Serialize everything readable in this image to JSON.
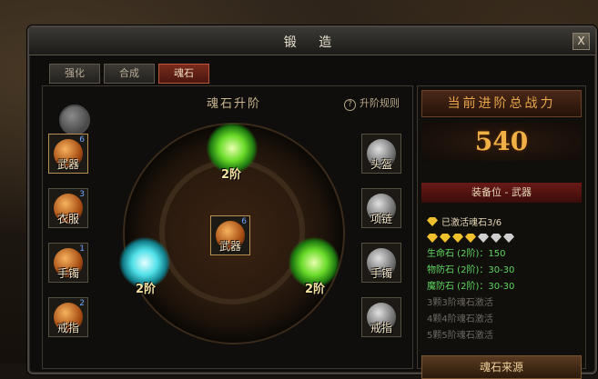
{
  "window": {
    "title": "锻 造",
    "close_label": "X"
  },
  "tabs": [
    {
      "label": "强化",
      "active": false
    },
    {
      "label": "合成",
      "active": false
    },
    {
      "label": "魂石",
      "active": true
    }
  ],
  "main": {
    "section_title": "魂石升阶",
    "rules_label": "升阶规则",
    "left_slots": [
      {
        "label": "武器",
        "num": "6",
        "selected": true
      },
      {
        "label": "衣服",
        "num": "3"
      },
      {
        "label": "手镯",
        "num": "1"
      },
      {
        "label": "戒指",
        "num": "2"
      }
    ],
    "right_slots": [
      {
        "label": "头盔"
      },
      {
        "label": "项链"
      },
      {
        "label": "手镯"
      },
      {
        "label": "戒指"
      }
    ],
    "center": {
      "label": "武器",
      "num": "6"
    },
    "orbs": [
      {
        "color": "#6bdc2a",
        "label": "2阶"
      },
      {
        "color": "#4fe0e8",
        "label": "2阶"
      },
      {
        "color": "#6bdc2a",
        "label": "2阶"
      }
    ]
  },
  "side": {
    "header": "当前进阶总战力",
    "power": "540",
    "position": "装备位 - 武器",
    "activated": "已激活魂石3/6",
    "diamonds": {
      "gold": 4,
      "silver": 3
    },
    "stats": [
      {
        "text": "生命石 (2阶)：150",
        "active": true
      },
      {
        "text": "物防石 (2阶)：30-30",
        "active": true
      },
      {
        "text": "魔防石 (2阶)：30-30",
        "active": true
      },
      {
        "text": "3颗3阶魂石激活",
        "active": false
      },
      {
        "text": "4颗4阶魂石激活",
        "active": false
      },
      {
        "text": "5颗5阶魂石激活",
        "active": false
      }
    ],
    "source_button": "魂石来源"
  }
}
